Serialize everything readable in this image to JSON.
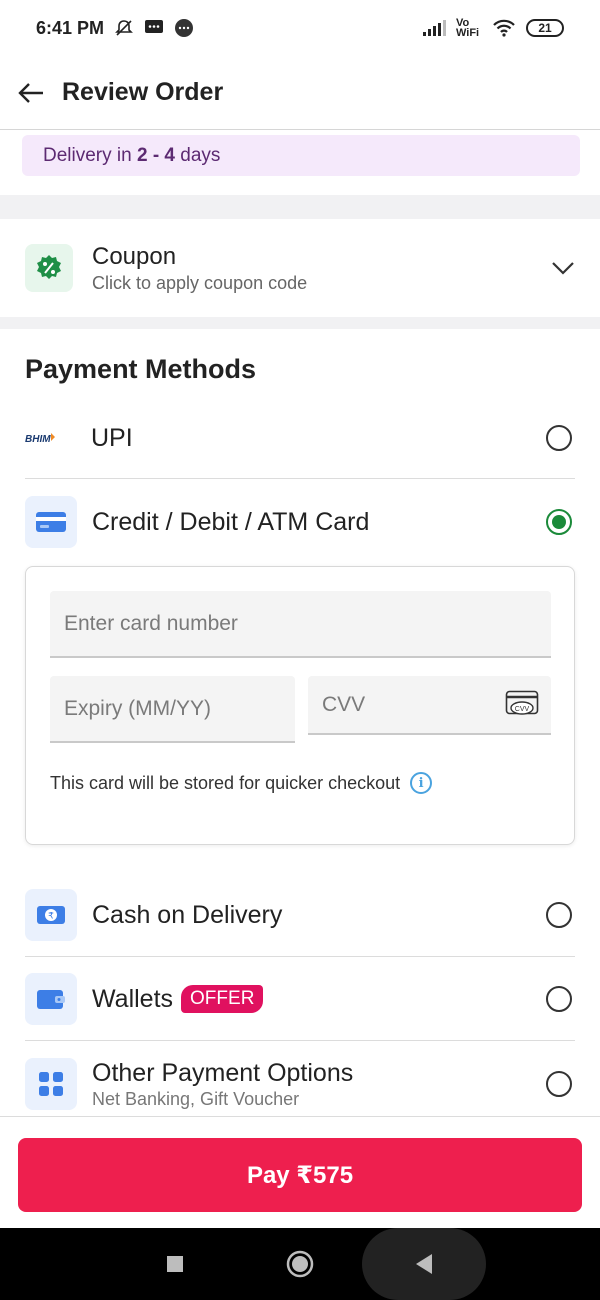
{
  "status_bar": {
    "time": "6:41 PM",
    "network_label": "Vo WiFi",
    "battery": "21"
  },
  "header": {
    "title": "Review Order"
  },
  "delivery": {
    "prefix": "Delivery in ",
    "range": "2 - 4",
    "suffix": " days"
  },
  "coupon": {
    "title": "Coupon",
    "subtitle": "Click to apply coupon code"
  },
  "payment": {
    "section_title": "Payment Methods",
    "upi": {
      "label": "UPI",
      "logo_text": "BHIM Pay",
      "selected": false
    },
    "card": {
      "label": "Credit / Debit / ATM Card",
      "selected": true,
      "card_number_placeholder": "Enter card number",
      "expiry_placeholder": "Expiry (MM/YY)",
      "cvv_placeholder": "CVV",
      "cvv_icon_text": "CVV",
      "store_note": "This card will be stored for quicker checkout"
    },
    "cod": {
      "label": "Cash on Delivery",
      "selected": false
    },
    "wallets": {
      "label": "Wallets",
      "badge": "OFFER",
      "selected": false
    },
    "other": {
      "label": "Other Payment Options",
      "subtitle": "Net Banking, Gift Voucher",
      "selected": false
    }
  },
  "pay_button": {
    "label": "Pay ₹575"
  },
  "colors": {
    "accent": "#ee1f4e",
    "selected_radio": "#1b8a3a",
    "offer_badge": "#e0115f",
    "delivery_bg": "#f5e9fb"
  }
}
